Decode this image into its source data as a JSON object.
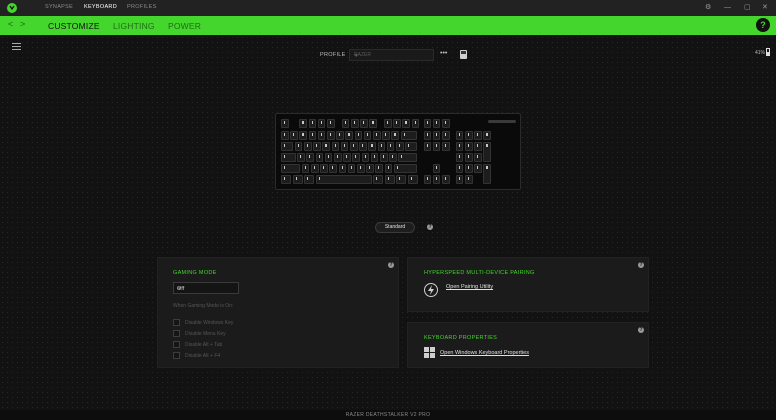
{
  "titlebar": {
    "tabs": [
      {
        "label": "SYNAPSE",
        "active": false
      },
      {
        "label": "KEYBOARD",
        "active": true
      },
      {
        "label": "PROFILES",
        "active": false
      }
    ],
    "controls": {
      "settings": "⚙",
      "minimize": "—",
      "maximize": "▢",
      "close": "✕"
    }
  },
  "nav": {
    "back": "<",
    "forward": ">",
    "tabs": [
      {
        "label": "CUSTOMIZE",
        "active": true
      },
      {
        "label": "LIGHTING",
        "active": false
      },
      {
        "label": "POWER",
        "active": false
      }
    ],
    "help": "?"
  },
  "profile": {
    "label": "PROFILE",
    "value": "RAZER",
    "more": "•••"
  },
  "battery": {
    "percent_text": "41%"
  },
  "keyboard_view": {
    "mode_button": "Standard"
  },
  "gaming_mode": {
    "title": "GAMING MODE",
    "selected": "Off",
    "when_enabled_label": "When Gaming Mode is On:",
    "options": [
      {
        "label": "Disable Windows Key",
        "checked": false
      },
      {
        "label": "Disable Menu Key",
        "checked": false
      },
      {
        "label": "Disable Alt + Tab",
        "checked": false
      },
      {
        "label": "Disable Alt + F4",
        "checked": false
      }
    ]
  },
  "hyperspeed": {
    "title": "HYPERSPEED MULTI-DEVICE PAIRING",
    "link": "Open Pairing Utility"
  },
  "keyboard_properties": {
    "title": "KEYBOARD PROPERTIES",
    "link": "Open Windows Keyboard Properties"
  },
  "status": {
    "device_name": "RAZER DEATHSTALKER V2 PRO"
  },
  "colors": {
    "accent": "#44d62c",
    "background": "#111111",
    "panel": "#1b1b1b"
  }
}
